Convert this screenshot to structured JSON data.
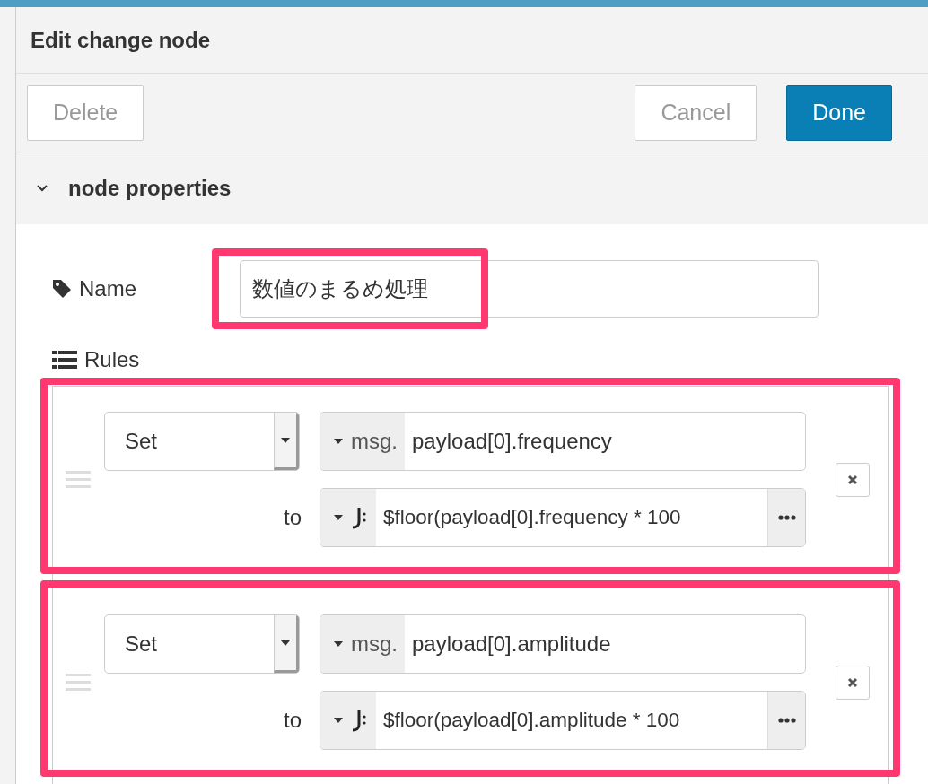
{
  "dialog": {
    "title": "Edit change node"
  },
  "buttons": [
    {
      "label": "Delete",
      "kind": "plain"
    },
    {
      "label": "Cancel",
      "kind": "plain"
    },
    {
      "label": "Done",
      "kind": "primary"
    }
  ],
  "section": {
    "title": "node properties",
    "expanded": true
  },
  "name_field": {
    "label": "Name",
    "value": "数値のまるめ処理",
    "highlighted": true
  },
  "rules_label": "Rules",
  "rules": [
    {
      "action": "Set",
      "target_prefix": "msg.",
      "target": "payload[0].frequency",
      "to_label": "to",
      "value": "$floor(payload[0].frequency * 100",
      "highlighted": true
    },
    {
      "action": "Set",
      "target_prefix": "msg.",
      "target": "payload[0].amplitude",
      "to_label": "to",
      "value": "$floor(payload[0].amplitude * 100",
      "highlighted": true
    }
  ]
}
